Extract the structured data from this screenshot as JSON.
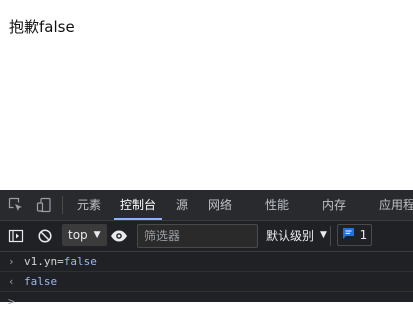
{
  "page": {
    "text": "抱歉false"
  },
  "devtools": {
    "tabs": [
      {
        "label": "元素"
      },
      {
        "label": "控制台"
      },
      {
        "label": "源"
      },
      {
        "label": "网络"
      },
      {
        "label": "性能"
      },
      {
        "label": "内存"
      },
      {
        "label": "应用程"
      }
    ],
    "active_tab": "控制台",
    "toolbar": {
      "context": "top",
      "filter_placeholder": "筛选器",
      "level": "默认级别",
      "issues_count": "1"
    },
    "console": {
      "input_line": {
        "var": "v1.yn",
        "op": "=",
        "value": "false"
      },
      "result_line": "false",
      "prompt_symbol": ">"
    },
    "colors": {
      "background": "#202124",
      "accent": "#8ab4f8",
      "value": "#9ab7f5",
      "badge": "#1a73e8"
    }
  }
}
